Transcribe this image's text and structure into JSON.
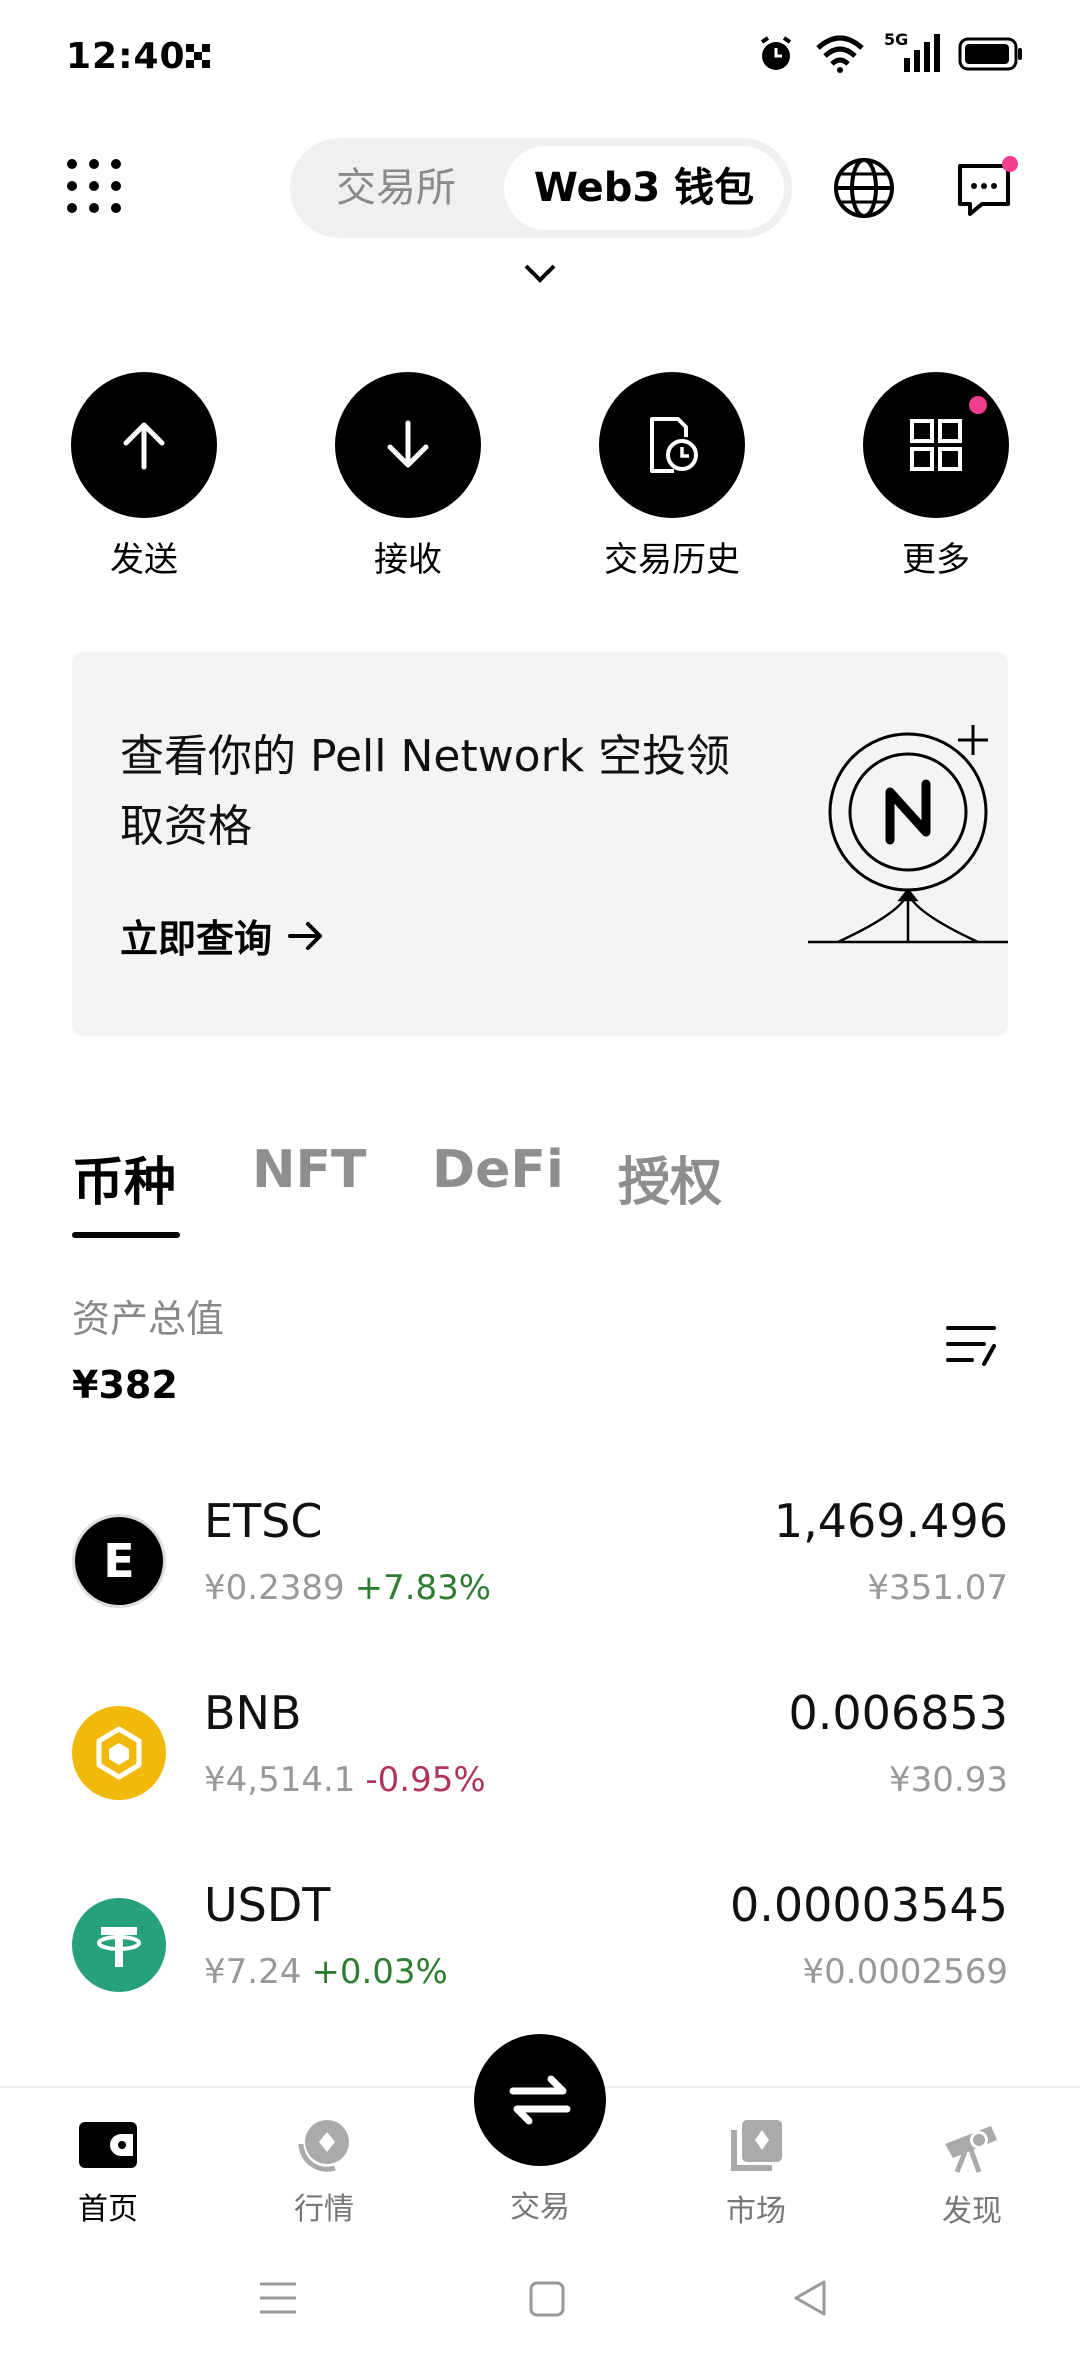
{
  "status": {
    "time": "12:40",
    "network": "5G"
  },
  "header": {
    "segment_left": "交易所",
    "segment_right": "Web3 钱包"
  },
  "actions": [
    {
      "label": "发送",
      "icon": "arrow-up-icon"
    },
    {
      "label": "接收",
      "icon": "arrow-down-icon"
    },
    {
      "label": "交易历史",
      "icon": "history-icon"
    },
    {
      "label": "更多",
      "icon": "grid-icon"
    }
  ],
  "banner": {
    "title": "查看你的 Pell Network 空投领取资格",
    "cta": "立即查询"
  },
  "tabs": [
    "币种",
    "NFT",
    "DeFi",
    "授权"
  ],
  "total": {
    "label": "资产总值",
    "value": "¥382"
  },
  "assets": [
    {
      "symbol": "ETSC",
      "price": "¥0.2389",
      "change": "+7.83%",
      "direction": "up",
      "amount": "1,469.496",
      "value": "¥351.07",
      "logo_color": "#000000",
      "logo_letter": "E"
    },
    {
      "symbol": "BNB",
      "price": "¥4,514.1",
      "change": "-0.95%",
      "direction": "down",
      "amount": "0.006853",
      "value": "¥30.93",
      "logo_color": "#F0B90B"
    },
    {
      "symbol": "USDT",
      "price": "¥7.24",
      "change": "+0.03%",
      "direction": "up",
      "amount": "0.00003545",
      "value": "¥0.0002569",
      "logo_color": "#26A17B"
    }
  ],
  "bottom_nav": {
    "home": "首页",
    "market": "行情",
    "trade": "交易",
    "marketplace": "市场",
    "discover": "发现"
  },
  "colors": {
    "accent_dot": "#F23C8C",
    "up": "#2E7D32",
    "down": "#B0355A"
  }
}
